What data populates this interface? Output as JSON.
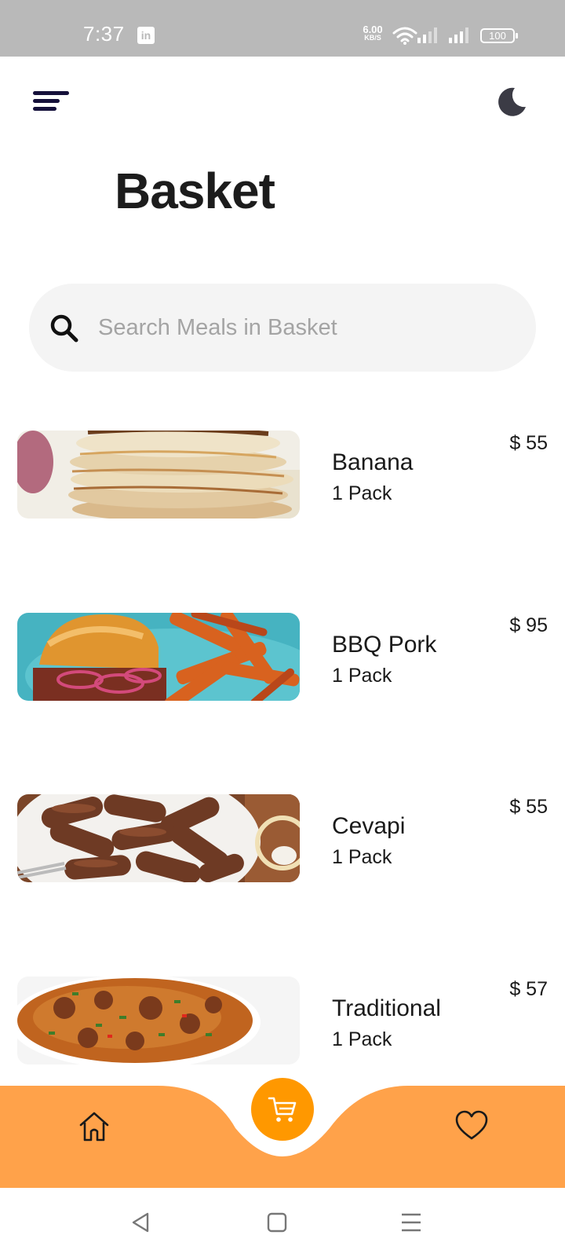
{
  "status_bar": {
    "time": "7:37",
    "app_badge": "in",
    "net_speed_value": "6.00",
    "net_speed_unit": "KB/S",
    "battery": "100"
  },
  "header": {
    "menu_icon": "hamburger-menu-icon",
    "theme_icon": "moon-icon",
    "title": "Basket"
  },
  "search": {
    "placeholder": "Search Meals in Basket",
    "value": ""
  },
  "items": [
    {
      "name": "Banana",
      "qty": "1 Pack",
      "price": "$ 55",
      "image": "pancakes"
    },
    {
      "name": "BBQ Pork",
      "qty": "1 Pack",
      "price": "$ 95",
      "image": "pork-sandwich-fries"
    },
    {
      "name": "Cevapi",
      "qty": "1 Pack",
      "price": "$ 55",
      "image": "cevapi"
    },
    {
      "name": "Traditional",
      "qty": "1 Pack",
      "price": "$ 57",
      "image": "stew"
    }
  ],
  "bottom_nav": {
    "items": [
      "home-icon",
      "cart-icon",
      "heart-icon"
    ],
    "accent": "#ffa24a",
    "active_accent": "#ff9800"
  },
  "system_nav": [
    "back-icon",
    "home-square-icon",
    "recents-icon"
  ]
}
